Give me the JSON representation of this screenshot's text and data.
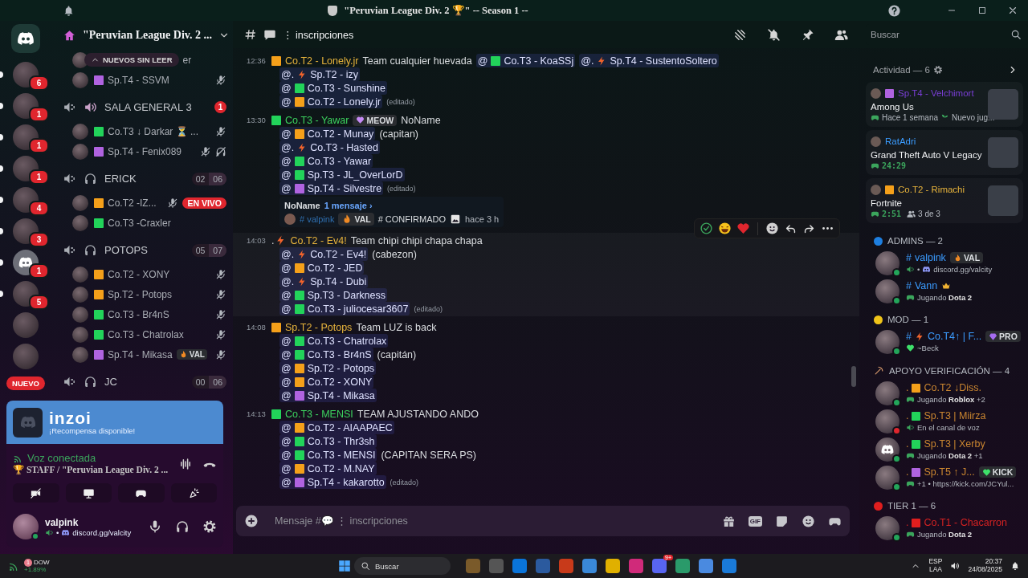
{
  "titlebar": {
    "title": "\"Peruvian League Div. 2 🏆\" -- Season 1 --"
  },
  "servers": [
    {
      "kind": "image",
      "badge": "6",
      "unread": true
    },
    {
      "kind": "image",
      "badge": "1",
      "unread": true
    },
    {
      "kind": "image",
      "badge": "1",
      "unread": true
    },
    {
      "kind": "image",
      "badge": "1",
      "unread": true
    },
    {
      "kind": "image",
      "badge": "4",
      "unread": true
    },
    {
      "kind": "image",
      "badge": "3",
      "unread": true
    },
    {
      "kind": "logo",
      "badge": "1",
      "unread": true
    },
    {
      "kind": "image",
      "badge": "5",
      "unread": true
    },
    {
      "kind": "image",
      "unread": false
    },
    {
      "kind": "image",
      "unread": false
    }
  ],
  "rail_label": "NUEVO",
  "server": {
    "name": "\"Peruvian League Div. 2 ..."
  },
  "top_users": [
    {
      "pill": "NUEVOS SIN LEER",
      "name": "er",
      "muted": false,
      "deafened": false
    },
    {
      "tag": {
        "kind": "square",
        "color": "#b063e0"
      },
      "name": "Sp.T4 - SSVM",
      "muted": true,
      "deafened": false
    }
  ],
  "voice_channels": [
    {
      "kind": "speaker",
      "name": "SALA GENERAL 3",
      "badge": "1",
      "users": [
        {
          "tag": {
            "kind": "square",
            "color": "#22d35a"
          },
          "name": "Co.T3 ↓ Darkar ⏳ ...",
          "muted": true,
          "deafened": false
        },
        {
          "tag": {
            "kind": "square",
            "color": "#b063e0"
          },
          "name": "Sp.T4 - Fenix089",
          "muted": true,
          "deafened": true
        }
      ]
    },
    {
      "kind": "headphones",
      "name": "ERICK",
      "count": "02",
      "limit": "06",
      "users": [
        {
          "tag": {
            "kind": "square",
            "color": "#f5a01a"
          },
          "name": "Co.T2 -IZ...",
          "muted": true,
          "deafened": false,
          "live": "EN VIVO"
        },
        {
          "tag": {
            "kind": "square",
            "color": "#22d35a"
          },
          "name": "Co.T3 -Craxler",
          "muted": false,
          "deafened": false
        }
      ]
    },
    {
      "kind": "headphones",
      "name": "POTOPS",
      "count": "05",
      "limit": "07",
      "users": [
        {
          "tag": {
            "kind": "square",
            "color": "#f5a01a"
          },
          "name": "Co.T2 - XONY",
          "muted": true,
          "deafened": false
        },
        {
          "tag": {
            "kind": "square",
            "color": "#f5a01a"
          },
          "name": "Sp.T2 - Potops",
          "muted": true,
          "deafened": false
        },
        {
          "tag": {
            "kind": "square",
            "color": "#22d35a"
          },
          "name": "Co.T3 - Br4nS",
          "muted": true,
          "deafened": false
        },
        {
          "tag": {
            "kind": "square",
            "color": "#22d35a"
          },
          "name": "Co.T3 - Chatrolax",
          "muted": true,
          "deafened": false
        },
        {
          "tag": {
            "kind": "square",
            "color": "#b063e0"
          },
          "name": "Sp.T4 - Mikasa",
          "badge": {
            "kind": "flame",
            "text": "VAL"
          },
          "muted": true,
          "deafened": false
        }
      ]
    },
    {
      "kind": "headphones",
      "name": "JC",
      "count": "00",
      "limit": "06"
    }
  ],
  "promo": {
    "logo": "inzoi",
    "text": "¡Recompensa disponible!"
  },
  "voice_panel": {
    "status": "Voz conectada",
    "channel": "🏆 STAFF / \"Peruvian League Div. 2 ..."
  },
  "user_panel": {
    "name": "valpink",
    "status": [
      {
        "kind": "voice"
      },
      {
        "kind": "text",
        "text": "•"
      },
      {
        "kind": "logo"
      },
      {
        "kind": "text",
        "text": "discord.gg/valcity"
      }
    ]
  },
  "chat": {
    "channel": "⋮ inscripciones",
    "messages": [
      {
        "time": "12:36",
        "author": {
          "tag": {
            "kind": "square",
            "color": "#f5a01a"
          },
          "name": "Co.T2 - Lonely.jr",
          "color": "#e8b43c"
        },
        "text": "Team cualquier huevada",
        "hovered": false,
        "mentions": [
          {
            "prefix": "@",
            "tag": {
              "kind": "square",
              "color": "#22d35a"
            },
            "name": "Co.T3 - KoaSSj"
          },
          {
            "prefix": "@.",
            "tag": {
              "kind": "bolt"
            },
            "name": "Sp.T4 - SustentoSoltero"
          }
        ],
        "lines": [
          {
            "prefix": "@.",
            "tag": {
              "kind": "bolt"
            },
            "name": "Sp.T2 - izy"
          },
          {
            "prefix": "@",
            "tag": {
              "kind": "square",
              "color": "#22d35a"
            },
            "name": "Co.T3 - Sunshine"
          },
          {
            "prefix": "@",
            "tag": {
              "kind": "square",
              "color": "#f5a01a"
            },
            "name": "Co.T2 - Lonely.jr",
            "edited": "(editado)"
          }
        ]
      },
      {
        "time": "13:30",
        "author": {
          "tag": {
            "kind": "square",
            "color": "#22d35a"
          },
          "name": "Co.T3 - Yawar",
          "color": "#3cd35e"
        },
        "badge": "MEOW",
        "text": "NoName",
        "hovered": false,
        "lines": [
          {
            "prefix": "@",
            "tag": {
              "kind": "square",
              "color": "#f5a01a"
            },
            "name": "Co.T2 - Munay",
            "note": "(capitan)"
          },
          {
            "prefix": "@.",
            "tag": {
              "kind": "bolt"
            },
            "name": "Co.T3 - Hasted"
          },
          {
            "prefix": "@",
            "tag": {
              "kind": "square",
              "color": "#22d35a"
            },
            "name": "Co.T3 - Yawar"
          },
          {
            "prefix": "@",
            "tag": {
              "kind": "square",
              "color": "#22d35a"
            },
            "name": "Sp.T3 - JL_OverLorD"
          },
          {
            "prefix": "@",
            "tag": {
              "kind": "square",
              "color": "#b063e0"
            },
            "name": "Sp.T4 - Silvestre",
            "edited": "(editado)"
          }
        ],
        "thread": {
          "title": "NoName",
          "count": "1 mensaje ›",
          "user": "# valpink",
          "badge": {
            "kind": "flame",
            "text": "VAL"
          },
          "text": "# CONFIRMADO",
          "time": "hace 3 h"
        }
      },
      {
        "time": "14:03",
        "author": {
          "prefix": ".",
          "tag": {
            "kind": "bolt"
          },
          "name": "Co.T2 - Ev4!",
          "color": "#e8b43c"
        },
        "text": "Team chipi chipi chapa chapa",
        "hovered": true,
        "lines": [
          {
            "prefix": "@.",
            "tag": {
              "kind": "bolt"
            },
            "name": "Co.T2 - Ev4!",
            "note": "(cabezon)"
          },
          {
            "prefix": "@",
            "tag": {
              "kind": "square",
              "color": "#f5a01a"
            },
            "name": "Co.T2 - JED"
          },
          {
            "prefix": "@.",
            "tag": {
              "kind": "bolt"
            },
            "name": "Sp.T4 - Dubi"
          },
          {
            "prefix": "@",
            "tag": {
              "kind": "square",
              "color": "#22d35a"
            },
            "name": "Sp.T3 - Darkness"
          },
          {
            "prefix": "@",
            "tag": {
              "kind": "square",
              "color": "#22d35a"
            },
            "name": "Co.T3 - juliocesar3607",
            "edited": "(editado)"
          }
        ]
      },
      {
        "time": "14:08",
        "author": {
          "tag": {
            "kind": "square",
            "color": "#f5a01a"
          },
          "name": "Sp.T2 - Potops",
          "color": "#e8b43c"
        },
        "text": "Team LUZ is back",
        "hovered": false,
        "lines": [
          {
            "prefix": "@",
            "tag": {
              "kind": "square",
              "color": "#22d35a"
            },
            "name": "Co.T3 - Chatrolax"
          },
          {
            "prefix": "@",
            "tag": {
              "kind": "square",
              "color": "#22d35a"
            },
            "name": "Co.T3 - Br4nS",
            "note": "(capitán)"
          },
          {
            "prefix": "@",
            "tag": {
              "kind": "square",
              "color": "#f5a01a"
            },
            "name": "Sp.T2 - Potops"
          },
          {
            "prefix": "@",
            "tag": {
              "kind": "square",
              "color": "#f5a01a"
            },
            "name": "Co.T2 - XONY"
          },
          {
            "prefix": "@",
            "tag": {
              "kind": "square",
              "color": "#b063e0"
            },
            "name": "Sp.T4 - Mikasa"
          }
        ]
      },
      {
        "time": "14:13",
        "author": {
          "tag": {
            "kind": "square",
            "color": "#22d35a"
          },
          "name": "Co.T3 - MENSI",
          "color": "#3cd35e"
        },
        "text": "TEAM AJUSTANDO ANDO",
        "hovered": false,
        "lines": [
          {
            "prefix": "@",
            "tag": {
              "kind": "square",
              "color": "#f5a01a"
            },
            "name": "Co.T2 - AIAAPAEC"
          },
          {
            "prefix": "@",
            "tag": {
              "kind": "square",
              "color": "#22d35a"
            },
            "name": "Co.T3 - Thr3sh"
          },
          {
            "prefix": "@",
            "tag": {
              "kind": "square",
              "color": "#22d35a"
            },
            "name": "Co.T3 - MENSI",
            "note": "(CAPITAN SERA PS)"
          },
          {
            "prefix": "@",
            "tag": {
              "kind": "square",
              "color": "#f5a01a"
            },
            "name": "Co.T2 - M.NAY"
          },
          {
            "prefix": "@",
            "tag": {
              "kind": "square",
              "color": "#b063e0"
            },
            "name": "Sp.T4 - kakarotto",
            "edited": "(editado)"
          }
        ]
      }
    ],
    "composer": {
      "placeholder": "Mensaje #💬 ⋮ inscripciones",
      "gif": "GIF"
    }
  },
  "members": {
    "search": {
      "placeholder": "Buscar"
    },
    "activity_title": "Actividad — 6",
    "activities": [
      {
        "tag": {
          "kind": "square",
          "color": "#b063e0"
        },
        "user": "Sp.T4 - Velchimort",
        "color": "#7a3ed6",
        "game": "Among Us",
        "meta": [
          {
            "kind": "gamepad"
          },
          {
            "kind": "text",
            "text": "Hace 1 semana"
          },
          {
            "kind": "sprout"
          },
          {
            "kind": "text",
            "text": "Nuevo jug..."
          }
        ]
      },
      {
        "user": "RatAdri",
        "color": "#3b9cff",
        "game": "Grand Theft Auto V Legacy",
        "meta": [
          {
            "kind": "gamepad"
          },
          {
            "kind": "timer",
            "text": "24:29"
          }
        ]
      },
      {
        "tag": {
          "kind": "square",
          "color": "#f5a01a"
        },
        "user": "Co.T2 - Rimachi",
        "color": "#e8b43c",
        "game": "Fortnite",
        "meta": [
          {
            "kind": "gamepad"
          },
          {
            "kind": "timer",
            "text": "2:51"
          },
          {
            "kind": "people"
          },
          {
            "kind": "text",
            "text": "3 de 3"
          }
        ]
      }
    ],
    "groups": [
      {
        "title": "ADMINS — 2",
        "kind": "dot",
        "color": "#1e7fe0",
        "members": [
          {
            "kind": "image",
            "prefix": "#",
            "name": "valpink",
            "color": "#3b9cff",
            "dnd": false,
            "crown": false,
            "badge": {
              "kind": "flame",
              "text": "VAL"
            },
            "status": [
              {
                "kind": "voice"
              },
              {
                "kind": "text",
                "text": "•"
              },
              {
                "kind": "logo"
              },
              {
                "kind": "text",
                "text": "discord.gg/valcity"
              }
            ]
          },
          {
            "kind": "image",
            "prefix": "#",
            "name": "Vann",
            "color": "#3b9cff",
            "dnd": false,
            "crown": true,
            "status": [
              {
                "kind": "gamepad"
              },
              {
                "kind": "text",
                "text": "Jugando **Dota 2**"
              }
            ]
          }
        ]
      },
      {
        "title": "MOD — 1",
        "kind": "dot",
        "color": "#f0c419",
        "members": [
          {
            "kind": "image",
            "prefix": "#",
            "tag": {
              "kind": "bolt"
            },
            "name": "Co.T4↑ | F...",
            "color": "#3b9cff",
            "dnd": false,
            "crown": false,
            "badge": {
              "kind": "gem",
              "text": "PRO"
            },
            "status": [
              {
                "kind": "heart"
              },
              {
                "kind": "text",
                "text": "~Beck"
              }
            ]
          }
        ]
      },
      {
        "title": "APOYO VERIFICACIÓN — 4",
        "kind": "pick",
        "members": [
          {
            "kind": "image",
            "prefix": ".",
            "tag": {
              "kind": "square",
              "color": "#f5a01a"
            },
            "name": "Co.T2 ↓Diss.",
            "color": "#c98530",
            "dnd": false,
            "crown": false,
            "status": [
              {
                "kind": "gamepad"
              },
              {
                "kind": "text",
                "text": "Jugando **Roblox** +2"
              }
            ]
          },
          {
            "kind": "image",
            "prefix": ".",
            "tag": {
              "kind": "square",
              "color": "#22d35a"
            },
            "name": "Sp.T3 | Miirza",
            "color": "#c98530",
            "dnd": true,
            "crown": false,
            "status": [
              {
                "kind": "voice"
              },
              {
                "kind": "text",
                "text": "En el canal de voz"
              }
            ]
          },
          {
            "kind": "logo",
            "prefix": ".",
            "tag": {
              "kind": "square",
              "color": "#22d35a"
            },
            "name": "Sp.T3 | Xerby",
            "color": "#c98530",
            "dnd": false,
            "crown": false,
            "status": [
              {
                "kind": "gamepad"
              },
              {
                "kind": "text",
                "text": "Jugando **Dota 2** +1"
              }
            ]
          },
          {
            "kind": "image",
            "prefix": ".",
            "tag": {
              "kind": "square",
              "color": "#b063e0"
            },
            "name": "Sp.T5 ↑ J...",
            "color": "#c98530",
            "dnd": false,
            "crown": false,
            "badge": {
              "kind": "heart",
              "text": "KICK"
            },
            "status": [
              {
                "kind": "gamepad"
              },
              {
                "kind": "text",
                "text": "+1 • https://kick.com/JCYul..."
              }
            ]
          }
        ]
      },
      {
        "title": "TIER 1 — 6",
        "kind": "dot",
        "color": "#e01e1e",
        "members": [
          {
            "kind": "image",
            "prefix": ".",
            "tag": {
              "kind": "square",
              "color": "#e01e1e"
            },
            "name": "Co.T1 - Chacarron",
            "color": "#d42222",
            "dnd": false,
            "crown": false,
            "status": [
              {
                "kind": "gamepad"
              },
              {
                "kind": "text",
                "text": "Jugando **Dota 2**"
              }
            ]
          }
        ]
      }
    ]
  },
  "taskbar": {
    "widget": {
      "badge": "1",
      "name": "DOW",
      "change": "+1.89%"
    },
    "search": {
      "placeholder": "Buscar"
    },
    "app_badge": "9+",
    "lang": "ESP",
    "layout": "LAA",
    "time": "20:37",
    "date": "24/08/2025"
  }
}
